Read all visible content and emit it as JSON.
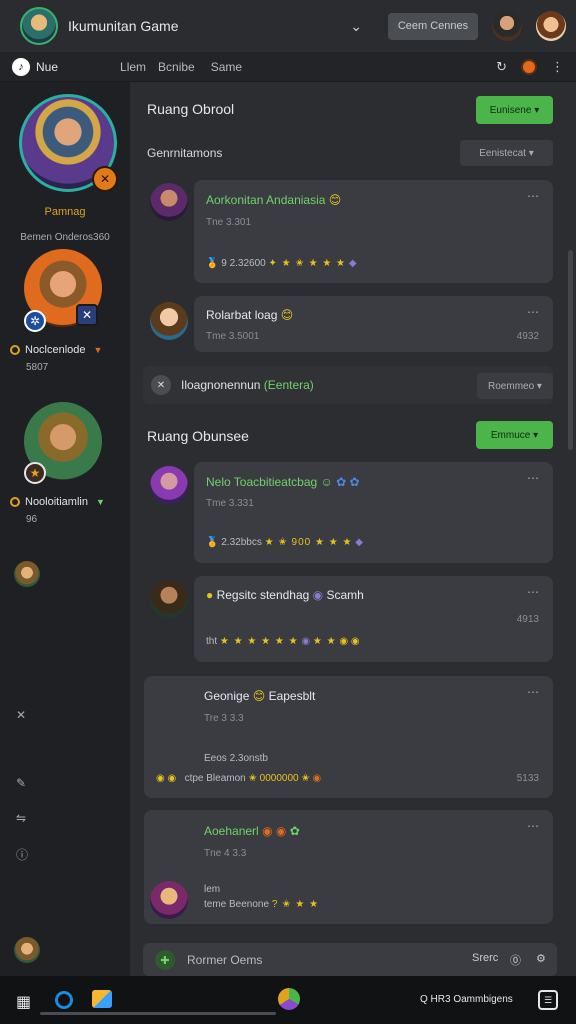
{
  "titlebar": {
    "title": "Ikumunitan Game",
    "chevron": "⌄",
    "button_label": "Ceem Cennes"
  },
  "navbar": {
    "home_label": "Nue",
    "tabs": [
      "Llem",
      "Bcnibe",
      "Same"
    ],
    "right_icons": [
      "refresh-icon",
      "orange-status-icon",
      "more-icon"
    ]
  },
  "sidebar": {
    "main_hero_label": "Pamnag",
    "main_hero_sub": "Bemen Onderos360",
    "hero1_name": "Noclcenlode",
    "hero1_value": "5807",
    "hero2_name": "Nooloitiamlin",
    "hero2_value": "96",
    "bottom_icons": [
      "close-icon",
      "edit-icon",
      "link-icon",
      "info-icon"
    ]
  },
  "sections": [
    {
      "title": "Ruang Obrool",
      "button_label": "Eunisene",
      "subheading": "Genrnitamons",
      "select_label": "Eenistecat",
      "cards": [
        {
          "title": "Aorkonitan Andaniasia",
          "meta": "Tne  3.301",
          "row": "9 2.32600",
          "right": ""
        },
        {
          "title": "Rolarbat loag",
          "meta": "Tme 3.5001",
          "row": "",
          "right": "4932"
        }
      ]
    },
    {
      "divider_text": "Iloagnonennun",
      "divider_green": "(Eentera)",
      "divider_select": "Roemmeo",
      "title": "Ruang Obunsee",
      "button_label": "Emmuce",
      "cards": [
        {
          "title": "Nelo Toacbitieatcbag",
          "meta": "Tme 3.331",
          "row": "2.32bbcs",
          "right": ""
        },
        {
          "title": "Regsitc stendhag",
          "meta": "",
          "row": "tht",
          "right": "4913",
          "extra": "Scamh"
        },
        {
          "title": "Geonige",
          "meta": "Tre 3 3.3",
          "row": "Eeos 2.3onstb",
          "right": "5133",
          "extra": "Eapesblt",
          "row2": "ctpe Bleamon"
        },
        {
          "title": "Aoehanerl",
          "meta": "Tne 4 3.3",
          "row": "lem",
          "right": "",
          "row2": "teme Beenone"
        }
      ]
    }
  ],
  "compose": {
    "placeholder": "Rormer Oems",
    "right_label": "Srerc"
  },
  "taskbar": {
    "tray_text": "Q  HR3 Oammbigens"
  }
}
